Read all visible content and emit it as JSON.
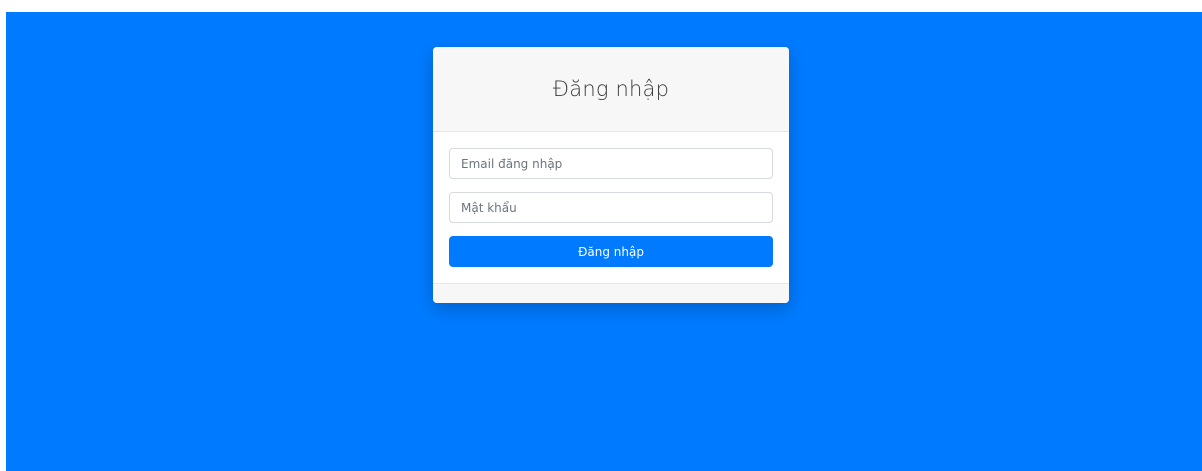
{
  "login": {
    "title": "Đăng nhập",
    "email_placeholder": "Email đăng nhập",
    "email_value": "",
    "password_placeholder": "Mật khẩu",
    "password_value": "",
    "submit_label": "Đăng nhập"
  },
  "colors": {
    "background": "#007bff",
    "primary_button": "#007bff",
    "card": "#ffffff",
    "card_header": "#f7f7f7"
  }
}
